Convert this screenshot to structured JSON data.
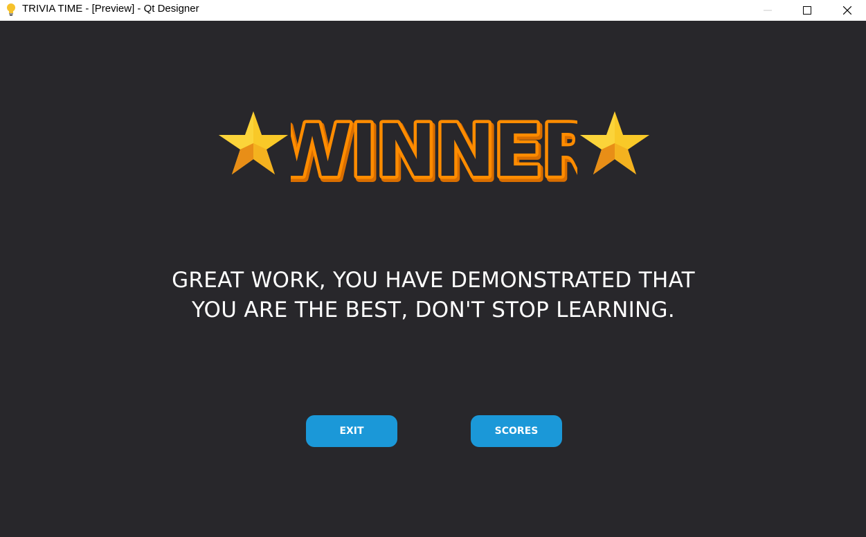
{
  "window": {
    "title": "TRIVIA TIME - [Preview] - Qt Designer",
    "icon": "lightbulb-icon",
    "controls": [
      "minimize-icon",
      "maximize-icon",
      "close-icon"
    ]
  },
  "banner": {
    "word": "WINNER",
    "left_icon": "star-icon",
    "right_icon": "star-icon"
  },
  "message": {
    "line1": "GREAT WORK, YOU HAVE DEMONSTRATED THAT",
    "line2": "YOU ARE THE BEST, DON'T STOP LEARNING."
  },
  "buttons": {
    "exit_label": "EXIT",
    "scores_label": "SCORES"
  },
  "colors": {
    "background": "#28272b",
    "accent_button": "#1b98d8",
    "winner_fill": "#ff8c00",
    "star": "#f5c518"
  }
}
